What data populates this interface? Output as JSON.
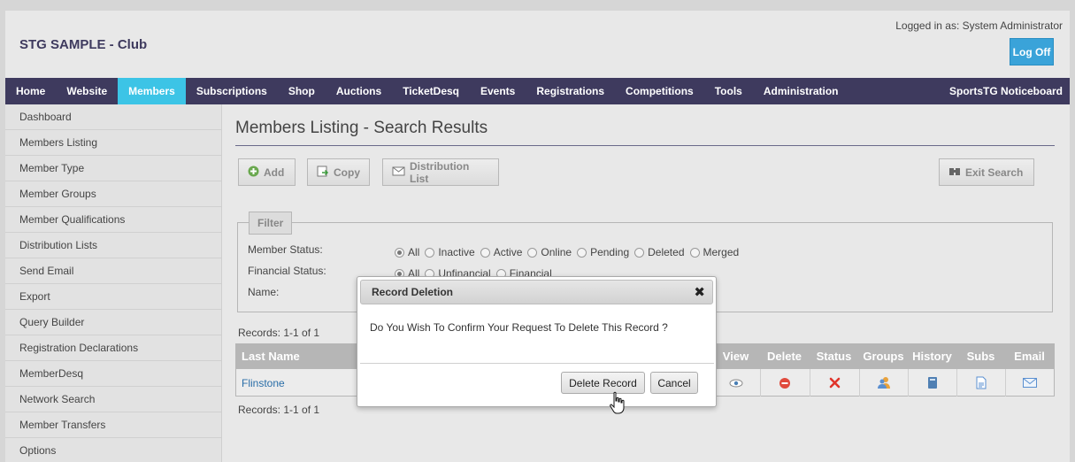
{
  "header": {
    "site_title": "STG SAMPLE - Club",
    "logged_in_text": "Logged in as: System Administrator",
    "logoff_label": "Log Off"
  },
  "nav": {
    "items": [
      {
        "label": "Home"
      },
      {
        "label": "Website"
      },
      {
        "label": "Members",
        "active": true
      },
      {
        "label": "Subscriptions"
      },
      {
        "label": "Shop"
      },
      {
        "label": "Auctions"
      },
      {
        "label": "TicketDesq"
      },
      {
        "label": "Events"
      },
      {
        "label": "Registrations"
      },
      {
        "label": "Competitions"
      },
      {
        "label": "Tools"
      },
      {
        "label": "Administration"
      }
    ],
    "right_label": "SportsTG Noticeboard"
  },
  "sidebar": {
    "items": [
      {
        "label": "Dashboard"
      },
      {
        "label": "Members Listing"
      },
      {
        "label": "Member Type"
      },
      {
        "label": "Member Groups"
      },
      {
        "label": "Member Qualifications"
      },
      {
        "label": "Distribution Lists"
      },
      {
        "label": "Send Email"
      },
      {
        "label": "Export"
      },
      {
        "label": "Query Builder"
      },
      {
        "label": "Registration Declarations"
      },
      {
        "label": "MemberDesq"
      },
      {
        "label": "Network Search"
      },
      {
        "label": "Member Transfers"
      },
      {
        "label": "Options"
      }
    ]
  },
  "main": {
    "heading": "Members Listing - Search Results",
    "toolbar": {
      "add_label": "Add",
      "copy_label": "Copy",
      "distribution_label": "Distribution List",
      "exit_search_label": "Exit Search"
    },
    "filter": {
      "legend": "Filter",
      "member_status_label": "Member Status:",
      "member_status_options": [
        "All",
        "Inactive",
        "Active",
        "Online",
        "Pending",
        "Deleted",
        "Merged"
      ],
      "member_status_selected": "All",
      "financial_status_label": "Financial Status:",
      "financial_status_options": [
        "All",
        "Unfinancial",
        "Financial"
      ],
      "financial_status_selected": "All",
      "name_label": "Name:"
    },
    "records_top": "Records: 1-1 of 1",
    "records_bottom": "Records: 1-1 of 1",
    "table": {
      "headers": {
        "last_name": "Last Name",
        "view": "View",
        "delete": "Delete",
        "status": "Status",
        "groups": "Groups",
        "history": "History",
        "subs": "Subs",
        "email": "Email"
      },
      "rows": [
        {
          "last_name": "Flinstone"
        }
      ]
    }
  },
  "modal": {
    "title": "Record Deletion",
    "message": "Do You Wish To Confirm Your Request To Delete This Record ?",
    "delete_label": "Delete Record",
    "cancel_label": "Cancel"
  },
  "colors": {
    "nav_bg": "#3e3a5e",
    "nav_active": "#3cc4e6",
    "logoff_bg": "#3aa3d9",
    "link": "#2a6ea8"
  }
}
